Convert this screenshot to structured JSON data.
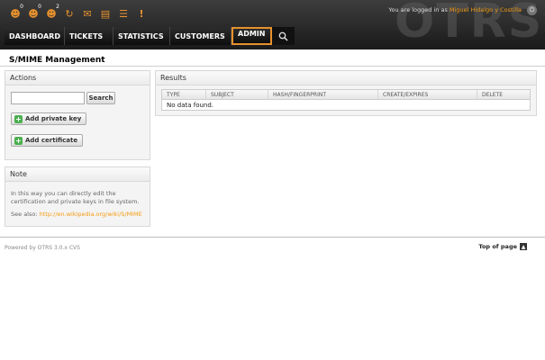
{
  "header": {
    "logo": "OTRS",
    "logged_in_prefix": "You are logged in as",
    "user_name": "Miguel Hidalgo y Costilla",
    "toolbar": [
      {
        "icon": "locked-tickets-icon",
        "glyph": "☻",
        "badge": "0"
      },
      {
        "icon": "watched-tickets-icon",
        "glyph": "☻",
        "badge": "0"
      },
      {
        "icon": "responsible-tickets-icon",
        "glyph": "☻",
        "badge": "2"
      },
      {
        "icon": "refresh-icon",
        "glyph": "↻",
        "badge": ""
      },
      {
        "icon": "email-icon",
        "glyph": "✉",
        "badge": ""
      },
      {
        "icon": "folder-icon",
        "glyph": "▤",
        "badge": ""
      },
      {
        "icon": "list-icon",
        "glyph": "☰",
        "badge": ""
      },
      {
        "icon": "alert-icon",
        "glyph": "!",
        "badge": ""
      }
    ],
    "nav": [
      "DASHBOARD",
      "TICKETS",
      "STATISTICS",
      "CUSTOMERS",
      "ADMIN"
    ],
    "active_nav": "ADMIN"
  },
  "page": {
    "title": "S/MIME Management"
  },
  "actions": {
    "heading": "Actions",
    "search_value": "",
    "search_button": "Search",
    "add_private_key": "Add private key",
    "add_certificate": "Add certificate"
  },
  "note": {
    "heading": "Note",
    "text": "In this way you can directly edit the certification and private keys in file system.",
    "see_also_label": "See also:",
    "link": "http://en.wikipedia.org/wiki/S/MIME"
  },
  "results": {
    "heading": "Results",
    "columns": [
      "TYPE",
      "SUBJECT",
      "HASH/FINGERPRINT",
      "CREATE/EXPIRES",
      "DELETE"
    ],
    "empty_message": "No data found."
  },
  "footer": {
    "powered_by": "Powered by OTRS 3.0.x CVS",
    "top_of_page": "Top of page"
  },
  "colors": {
    "accent": "#e8912d",
    "header_dark": "#1a1a1a",
    "link": "#f39c12",
    "add_icon": "#4caf50"
  }
}
